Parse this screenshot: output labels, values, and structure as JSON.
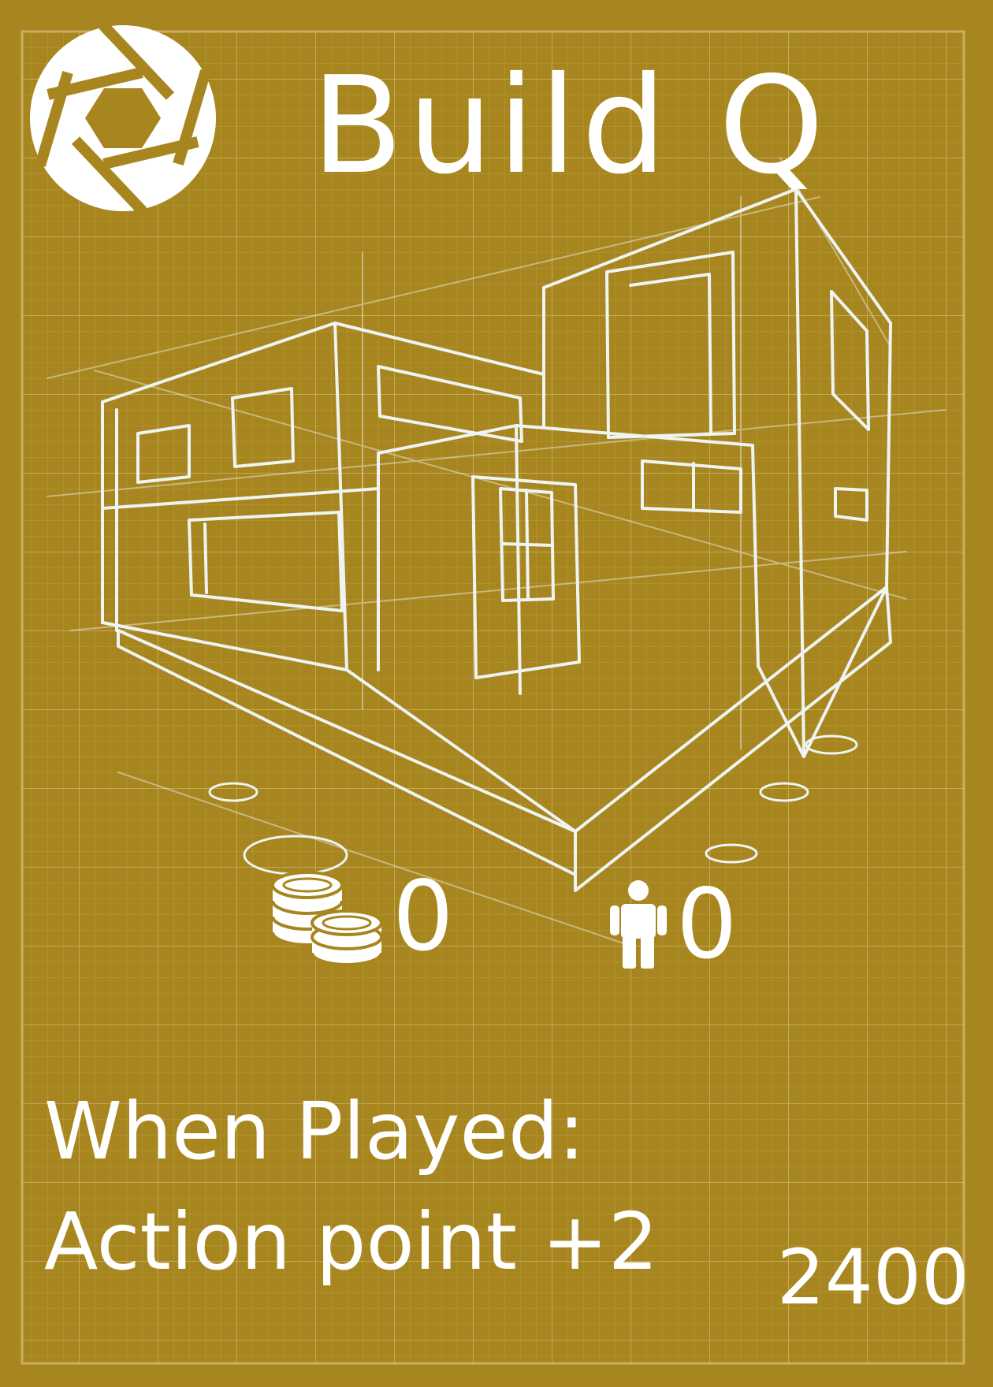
{
  "card": {
    "title": "Build Q",
    "logo_icon": "aperture-icon",
    "illustration": "house-blueprint-sketch",
    "costs": {
      "gold": {
        "icon": "coin-stack-icon",
        "value": "0"
      },
      "people": {
        "icon": "person-icon",
        "value": "0"
      }
    },
    "effect": {
      "line1": "When Played:",
      "line2": "Action point +2"
    },
    "price": "2400"
  },
  "colors": {
    "background": "#a8861f",
    "grid_line": "#c7ad5c",
    "sketch_line": "#eef4f2",
    "text": "#ffffff"
  }
}
